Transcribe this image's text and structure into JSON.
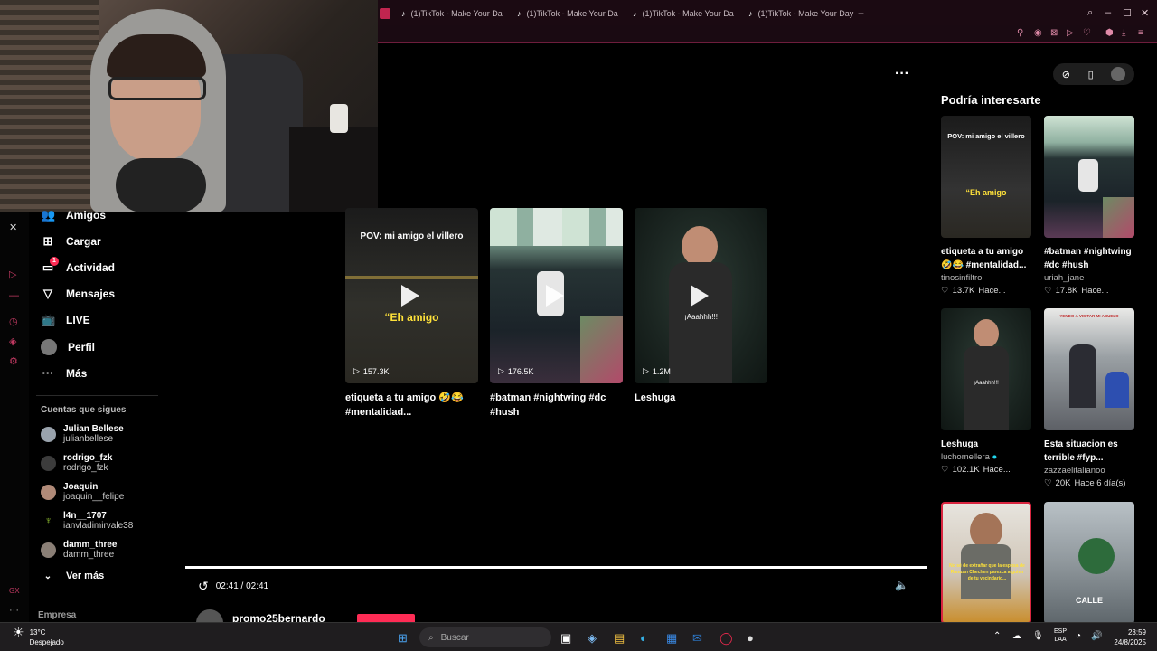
{
  "browser": {
    "tabs": [
      {
        "label": "(1)TikTok - Make Your Da"
      },
      {
        "label": "(1)TikTok - Make Your Da"
      },
      {
        "label": "(1)TikTok - Make Your Da"
      },
      {
        "label": "(1)TikTok - Make Your Day"
      }
    ],
    "accent": "#c0254f"
  },
  "nav": {
    "items": [
      {
        "label": "Amigos",
        "icon": "friends-icon"
      },
      {
        "label": "Cargar",
        "icon": "upload-icon"
      },
      {
        "label": "Actividad",
        "icon": "activity-icon",
        "badge": "1"
      },
      {
        "label": "Mensajes",
        "icon": "messages-icon"
      },
      {
        "label": "LIVE",
        "icon": "live-icon"
      },
      {
        "label": "Perfil",
        "icon": "profile-icon"
      },
      {
        "label": "Más",
        "icon": "more-icon"
      }
    ],
    "following_title": "Cuentas que sigues",
    "following": [
      {
        "name": "Julian Bellese",
        "handle": "julianbellese"
      },
      {
        "name": "rodrigo_fzk",
        "handle": "rodrigo_fzk"
      },
      {
        "name": "Joaquin",
        "handle": "joaquin__felipe"
      },
      {
        "name": "l4n__1707",
        "handle": "ianvladimirvale38"
      },
      {
        "name": "damm_three",
        "handle": "damm_three"
      }
    ],
    "see_more": "Ver más",
    "company": "Empresa"
  },
  "grid": [
    {
      "overlay": "POV: mi amigo el villero",
      "overlay2": "“Eh amigo",
      "views": "157.3K",
      "caption": "etiqueta a tu amigo 🤣😂 #mentalidad..."
    },
    {
      "overlay": "",
      "overlay2": "",
      "views": "176.5K",
      "caption": "#batman #nightwing #dc #hush"
    },
    {
      "overlay": "¡Aaahhh!!!",
      "overlay2": "",
      "views": "1.2M",
      "caption": "Leshuga"
    }
  ],
  "right_panel": {
    "title": "Podría interesarte",
    "cards": [
      {
        "caption": "etiqueta a tu amigo 🤣😂 #mentalidad...",
        "author": "tinosinfiltro",
        "likes": "13.7K",
        "time": "Hace...",
        "overlay": "POV: mi amigo el villero",
        "overlay2": "“Eh amigo"
      },
      {
        "caption": "#batman #nightwing #dc #hush",
        "author": "uriah_jane",
        "likes": "17.8K",
        "time": "Hace..."
      },
      {
        "caption": "Leshuga",
        "author": "luchomellera",
        "likes": "102.1K",
        "time": "Hace...",
        "overlay": "¡Aaahhh!!!"
      },
      {
        "caption": "Esta situacion es terrible #fyp...",
        "author": "zazzaelitalianoo",
        "likes": "20K",
        "time": "Hace 6 día(s)",
        "overlay": "YENDO A VISITAR MI ABUELO"
      },
      {
        "overlay": "No sé de extrañar que la esposa de Ramzan Chechen parezca alguien de tu vecindario..."
      },
      {
        "overlay": "CALLE"
      }
    ]
  },
  "player": {
    "time": "02:41 / 02:41",
    "below_user": "promo25bernardo"
  },
  "taskbar": {
    "weather_temp": "13°C",
    "weather_desc": "Despejado",
    "search_placeholder": "Buscar",
    "lang1": "ESP",
    "lang2": "LAA",
    "time": "23:59",
    "date": "24/8/2025"
  }
}
